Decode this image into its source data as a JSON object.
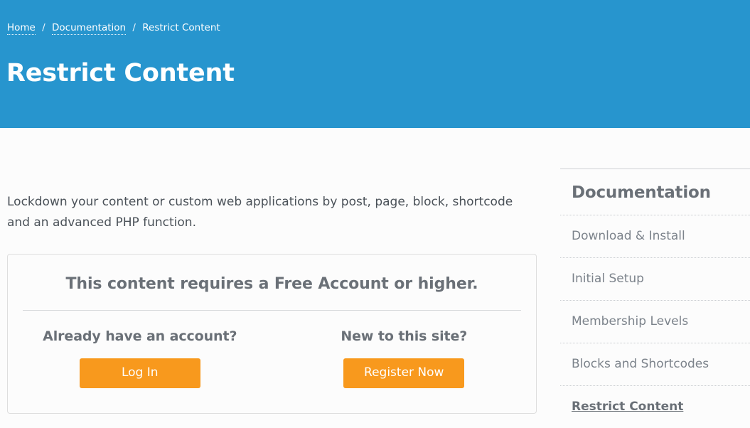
{
  "header": {
    "breadcrumb": {
      "items": [
        {
          "label": "Home",
          "is_link": true
        },
        {
          "label": "Documentation",
          "is_link": true
        },
        {
          "label": "Restrict Content",
          "is_link": false
        }
      ],
      "separator": "/"
    },
    "title": "Restrict Content",
    "background_color": "#2795ce"
  },
  "main": {
    "intro": "Lockdown your content or custom web applications by post, page, block, shortcode and an advanced PHP function.",
    "restriction": {
      "heading": "This content requires a Free Account or higher.",
      "login": {
        "title": "Already have an account?",
        "button_label": "Log In"
      },
      "register": {
        "title": "New to this site?",
        "button_label": "Register Now"
      },
      "button_color": "#f8991d"
    }
  },
  "sidebar": {
    "heading": "Documentation",
    "items": [
      {
        "label": "Download & Install",
        "active": false
      },
      {
        "label": "Initial Setup",
        "active": false
      },
      {
        "label": "Membership Levels",
        "active": false
      },
      {
        "label": "Blocks and Shortcodes",
        "active": false
      },
      {
        "label": "Restrict Content",
        "active": true
      }
    ]
  }
}
